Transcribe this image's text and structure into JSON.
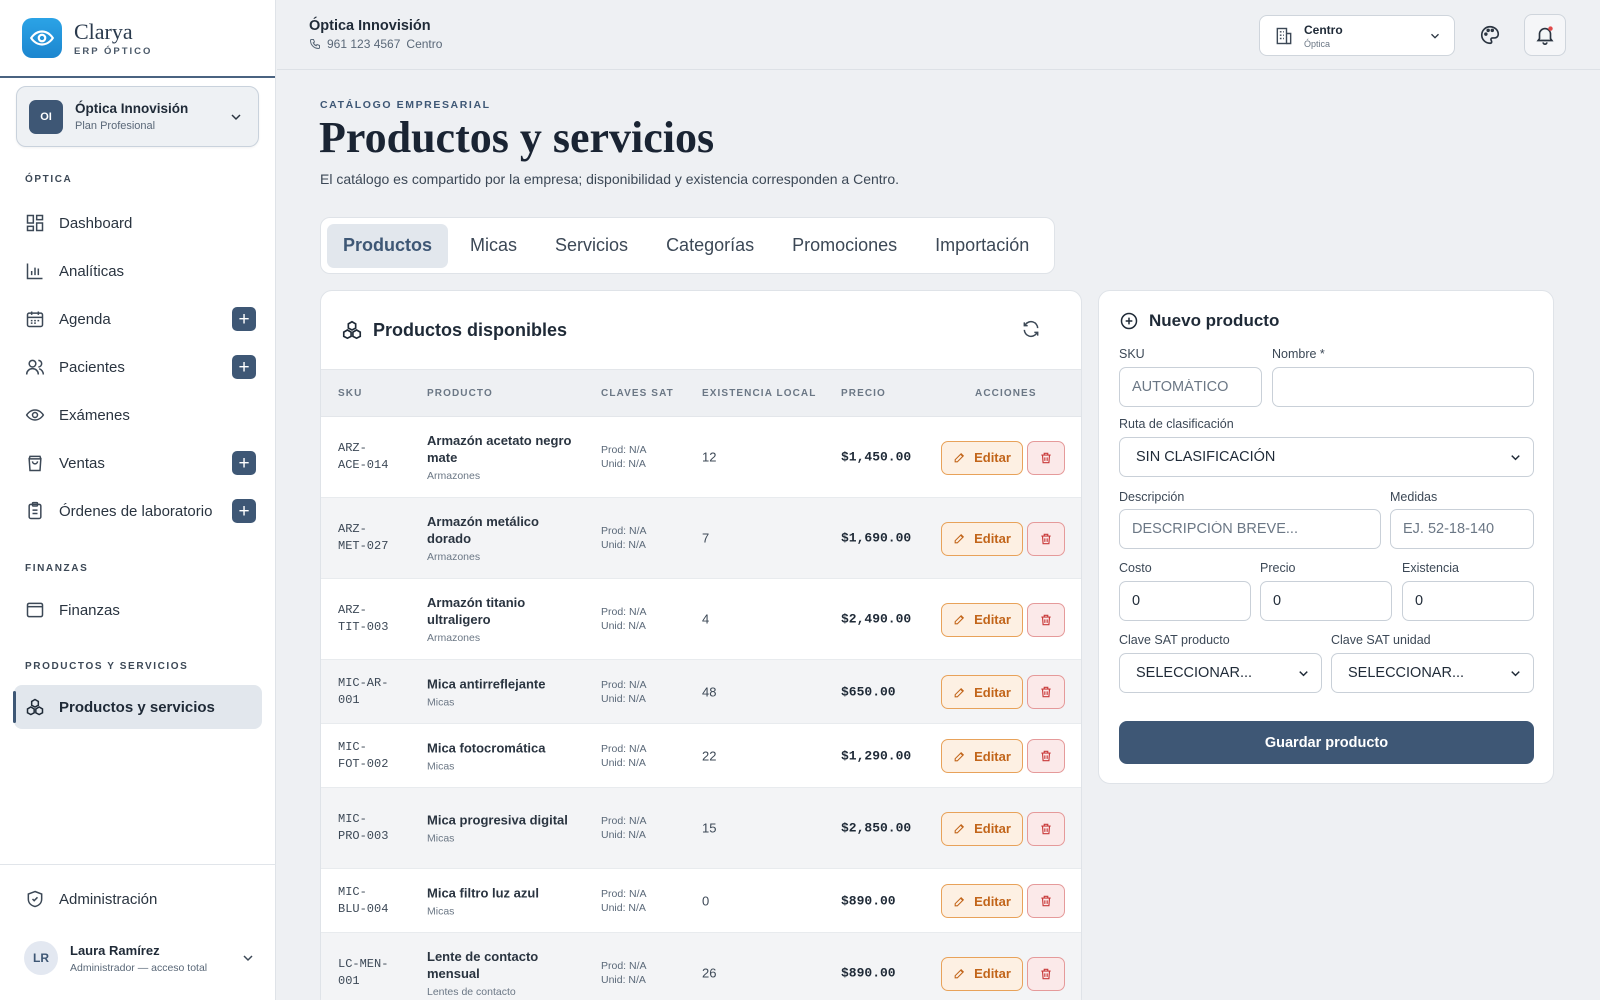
{
  "brand": {
    "name": "Clarya",
    "subtitle": "ERP ÓPTICO"
  },
  "org": {
    "initials": "OI",
    "name": "Óptica Innovisión",
    "plan": "Plan Profesional"
  },
  "nav": {
    "section_optica": "ÓPTICA",
    "section_finanzas": "FINANZAS",
    "section_productos": "PRODUCTOS Y SERVICIOS",
    "items": [
      {
        "label": "Dashboard",
        "icon": "dashboard-icon"
      },
      {
        "label": "Analíticas",
        "icon": "bar-chart-icon"
      },
      {
        "label": "Agenda",
        "icon": "calendar-icon"
      },
      {
        "label": "Pacientes",
        "icon": "users-icon"
      },
      {
        "label": "Exámenes",
        "icon": "eye-icon"
      },
      {
        "label": "Ventas",
        "icon": "shopping-bag-icon"
      },
      {
        "label": "Órdenes de laboratorio",
        "icon": "clipboard-icon"
      },
      {
        "label": "Finanzas",
        "icon": "wallet-icon"
      },
      {
        "label": "Productos y servicios",
        "icon": "boxes-icon"
      },
      {
        "label": "Administración",
        "icon": "shield-icon"
      }
    ]
  },
  "user": {
    "initials": "LR",
    "name": "Laura Ramírez",
    "role": "Administrador — acceso total"
  },
  "topbar": {
    "title": "Óptica Innovisión",
    "phone": "961 123 4567",
    "branch_label": "Centro"
  },
  "branch": {
    "name": "Centro",
    "sub": "Óptica"
  },
  "header": {
    "eyebrow": "CATÁLOGO EMPRESARIAL",
    "title": "Productos y servicios",
    "description": "El catálogo es compartido por la empresa; disponibilidad y existencia corresponden a Centro."
  },
  "tabs": [
    "Productos",
    "Micas",
    "Servicios",
    "Categorías",
    "Promociones",
    "Importación"
  ],
  "table": {
    "title": "Productos disponibles",
    "columns": [
      "SKU",
      "PRODUCTO",
      "CLAVES SAT",
      "EXISTENCIA LOCAL",
      "PRECIO",
      "ACCIONES"
    ],
    "edit_label": "Editar",
    "rows": [
      {
        "sku1": "ARZ-",
        "sku2": "ACE-014",
        "name": "Armazón acetato negro mate",
        "category": "Armazones",
        "sat1": "Prod: N/A",
        "sat2": "Unid: N/A",
        "stock": "12",
        "price": "$1,450.00"
      },
      {
        "sku1": "ARZ-",
        "sku2": "MET-027",
        "name": "Armazón metálico dorado",
        "category": "Armazones",
        "sat1": "Prod: N/A",
        "sat2": "Unid: N/A",
        "stock": "7",
        "price": "$1,690.00"
      },
      {
        "sku1": "ARZ-",
        "sku2": "TIT-003",
        "name": "Armazón titanio ultraligero",
        "category": "Armazones",
        "sat1": "Prod: N/A",
        "sat2": "Unid: N/A",
        "stock": "4",
        "price": "$2,490.00"
      },
      {
        "sku1": "MIC-AR-",
        "sku2": "001",
        "name": "Mica antirreflejante",
        "category": "Micas",
        "sat1": "Prod: N/A",
        "sat2": "Unid: N/A",
        "stock": "48",
        "price": "$650.00"
      },
      {
        "sku1": "MIC-",
        "sku2": "FOT-002",
        "name": "Mica fotocromática",
        "category": "Micas",
        "sat1": "Prod: N/A",
        "sat2": "Unid: N/A",
        "stock": "22",
        "price": "$1,290.00"
      },
      {
        "sku1": "MIC-",
        "sku2": "PRO-003",
        "name": "Mica progresiva digital",
        "category": "Micas",
        "sat1": "Prod: N/A",
        "sat2": "Unid: N/A",
        "stock": "15",
        "price": "$2,850.00"
      },
      {
        "sku1": "MIC-",
        "sku2": "BLU-004",
        "name": "Mica filtro luz azul",
        "category": "Micas",
        "sat1": "Prod: N/A",
        "sat2": "Unid: N/A",
        "stock": "0",
        "price": "$890.00"
      },
      {
        "sku1": "LC-MEN-",
        "sku2": "001",
        "name": "Lente de contacto mensual",
        "category": "Lentes de contacto",
        "sat1": "Prod: N/A",
        "sat2": "Unid: N/A",
        "stock": "26",
        "price": "$890.00"
      }
    ]
  },
  "form": {
    "title": "Nuevo producto",
    "sku_label": "SKU",
    "sku_placeholder": "AUTOMÁTICO",
    "name_label": "Nombre *",
    "name_value": "",
    "route_label": "Ruta de clasificación",
    "route_value": "SIN CLASIFICACIÓN",
    "desc_label": "Descripción",
    "desc_placeholder": "DESCRIPCIÓN BREVE...",
    "measures_label": "Medidas",
    "measures_placeholder": "EJ. 52-18-140",
    "cost_label": "Costo",
    "cost_value": "0",
    "price_label": "Precio",
    "price_value": "0",
    "stock_label": "Existencia",
    "stock_value": "0",
    "sat_product_label": "Clave SAT producto",
    "sat_product_value": "SELECCIONAR...",
    "sat_unit_label": "Clave SAT unidad",
    "sat_unit_value": "SELECCIONAR...",
    "save_label": "Guardar producto"
  },
  "colors": {
    "primary": "#3e5775",
    "brand": "#1c86cf",
    "edit": "#c2651a",
    "delete": "#c93b3b",
    "background": "#eef0f3"
  }
}
